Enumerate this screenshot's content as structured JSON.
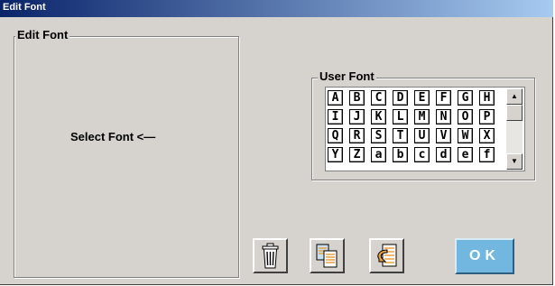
{
  "window": {
    "title": "Edit Font"
  },
  "edit_font": {
    "legend": "Edit Font",
    "placeholder": "Select Font <—"
  },
  "user_font": {
    "legend": "User Font",
    "rows": [
      [
        "A",
        "B",
        "C",
        "D",
        "E",
        "F",
        "G",
        "H"
      ],
      [
        "I",
        "J",
        "K",
        "L",
        "M",
        "N",
        "O",
        "P"
      ],
      [
        "Q",
        "R",
        "S",
        "T",
        "U",
        "V",
        "W",
        "X"
      ],
      [
        "Y",
        "Z",
        "a",
        "b",
        "c",
        "d",
        "e",
        "f"
      ]
    ],
    "scroll_up_glyph": "▲",
    "scroll_down_glyph": "▼"
  },
  "toolbar": {
    "delete_icon": "trash-icon",
    "copy_icon": "copy-pages-icon",
    "restore_icon": "restore-arrow-icon",
    "ok_label": "OK"
  },
  "colors": {
    "window_bg": "#d6d3ce",
    "title_start": "#0a246a",
    "title_end": "#a6caf0",
    "ok_bg": "#72b7e0",
    "icon_orange": "#e8a040",
    "icon_tint": "#c8e0f0"
  }
}
